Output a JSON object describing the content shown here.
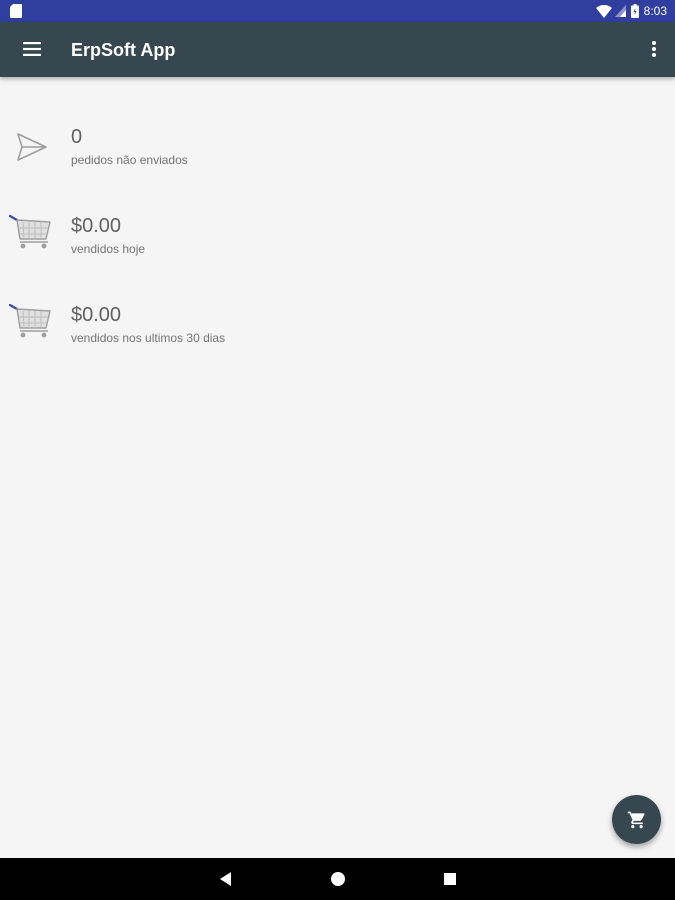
{
  "status_bar": {
    "time": "8:03",
    "icons": [
      "sd-card-icon",
      "wifi-icon",
      "signal-icon",
      "battery-icon"
    ]
  },
  "app_bar": {
    "title": "ErpSoft App",
    "menu_icon": "hamburger-menu-icon",
    "overflow_icon": "more-vert-icon"
  },
  "summary": {
    "items": [
      {
        "icon": "send-icon",
        "value": "0",
        "label": "pedidos não enviados"
      },
      {
        "icon": "shopping-cart-icon",
        "value": "$0.00",
        "label": "vendidos hoje"
      },
      {
        "icon": "shopping-cart-icon",
        "value": "$0.00",
        "label": "vendidos nos ultimos 30 dias"
      }
    ]
  },
  "fab": {
    "icon": "shopping-cart-icon"
  },
  "nav_bar": {
    "icons": [
      "back-icon",
      "home-icon",
      "recents-icon"
    ]
  },
  "colors": {
    "status_bar": "#303f9f",
    "app_bar": "#37474f",
    "background": "#f5f5f5",
    "fab": "#37474f",
    "nav_bar": "#000000"
  }
}
